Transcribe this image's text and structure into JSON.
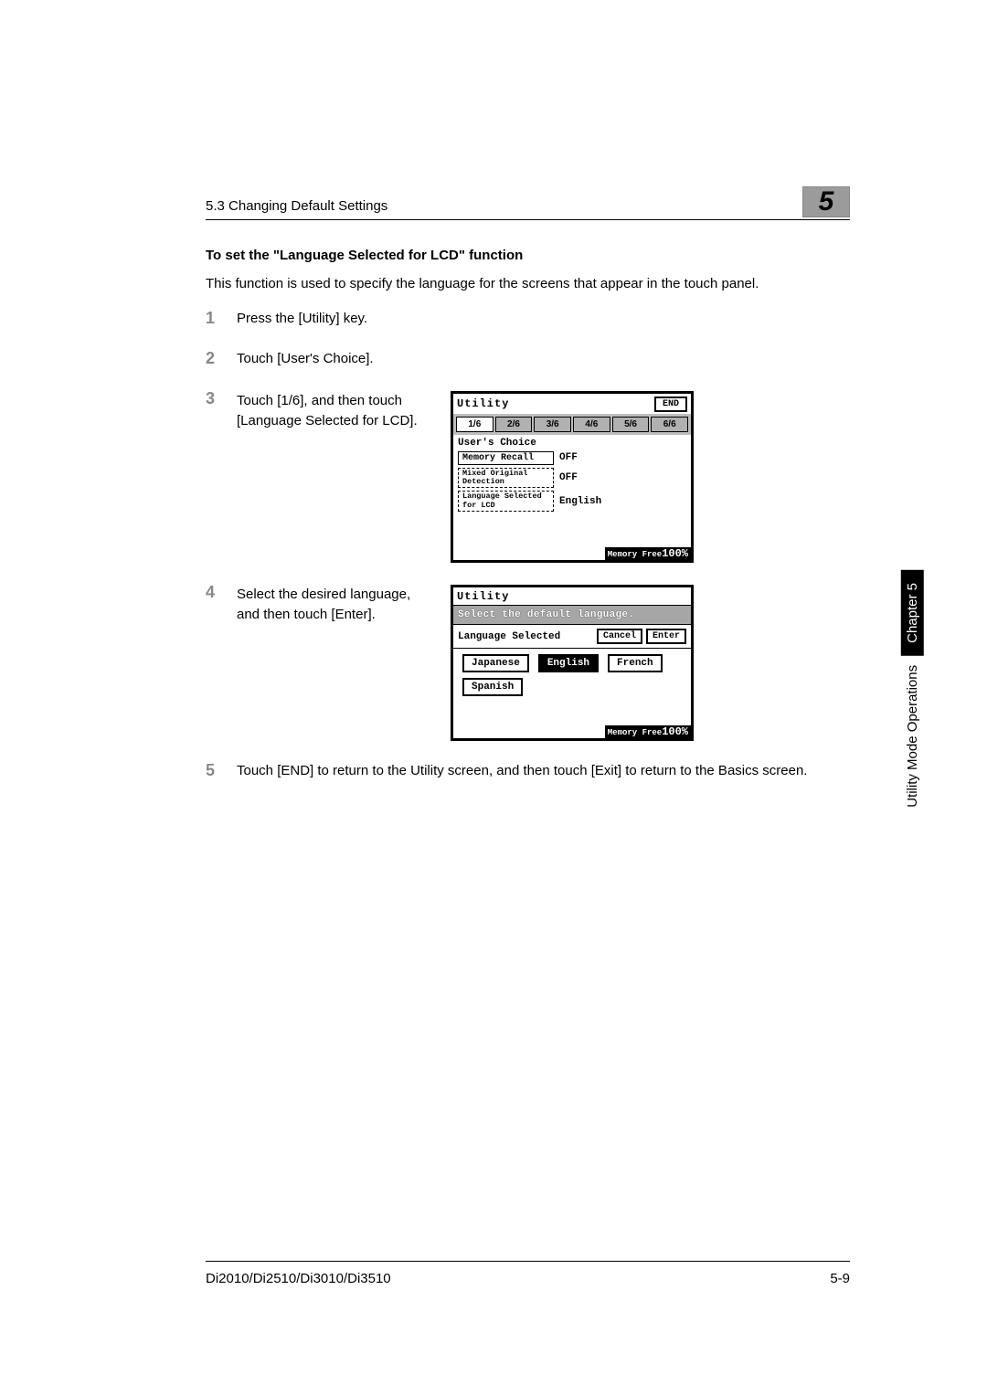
{
  "header": {
    "section": "5.3 Changing Default Settings",
    "chapter_num": "5"
  },
  "section_title": "To set the \"Language Selected for LCD\" function",
  "intro": "This function is used to specify the language for the screens that appear in the touch panel.",
  "steps": [
    {
      "num": "1",
      "text": "Press the [Utility] key."
    },
    {
      "num": "2",
      "text": "Touch [User's Choice]."
    },
    {
      "num": "3",
      "text": "Touch [1/6], and then touch [Language Selected for LCD]."
    },
    {
      "num": "4",
      "text": "Select the desired language, and then touch [Enter]."
    },
    {
      "num": "5",
      "text": "Touch [END] to return to the Utility screen, and then touch [Exit] to return to the Basics screen."
    }
  ],
  "lcd1": {
    "title": "Utility",
    "end": "END",
    "tabs": [
      "1/6",
      "2/6",
      "3/6",
      "4/6",
      "5/6",
      "6/6"
    ],
    "subhead": "User's Choice",
    "options": [
      {
        "label": "Memory Recall",
        "value": "OFF"
      },
      {
        "label": "Mixed Original Detection",
        "value": "OFF"
      },
      {
        "label": "Language Selected for LCD",
        "value": "English"
      }
    ],
    "mem_label": "Memory Free",
    "mem_value": "100%"
  },
  "lcd2": {
    "title": "Utility",
    "darkbar": "Select the default language.",
    "row_label": "Language Selected",
    "cancel": "Cancel",
    "enter": "Enter",
    "languages": [
      "Japanese",
      "English",
      "French",
      "Spanish"
    ],
    "active_lang": "English",
    "mem_label": "Memory Free",
    "mem_value": "100%"
  },
  "side": {
    "text": "Utility Mode Operations",
    "chapter": "Chapter 5"
  },
  "footer": {
    "model": "Di2010/Di2510/Di3010/Di3510",
    "page": "5-9"
  }
}
